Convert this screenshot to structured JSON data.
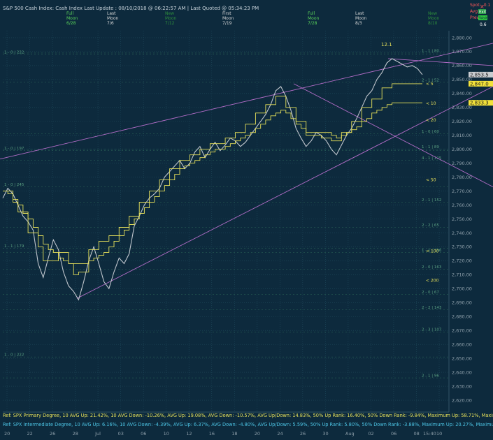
{
  "header": {
    "text": "S&P 500 Cash Index:  Cash Index  Last Update : 08/10/2018 @ 06:22:57 AM | Last Quoted @ 05:34:23 PM"
  },
  "moon_phases": [
    {
      "line1": "Full",
      "line2": "Moon",
      "line3": "6/28",
      "color": "#5ad35a"
    },
    {
      "line1": "Last",
      "line2": "Moon",
      "line3": "7/6",
      "color": "#d8d8d8"
    },
    {
      "line1": "New",
      "line2": "Moon",
      "line3": "7/12",
      "color": "#2e8f3c"
    },
    {
      "line1": "First",
      "line2": "Moon",
      "line3": "7/19",
      "color": "#d8d8d8"
    },
    {
      "line1": "Full",
      "line2": "Moon",
      "line3": "7/28",
      "color": "#5ad35a"
    },
    {
      "line1": "Last",
      "line2": "Moon",
      "line3": "8/3",
      "color": "#d8d8d8"
    },
    {
      "line1": "New",
      "line2": "Moon",
      "line3": "8/10",
      "color": "#2e8f3c"
    }
  ],
  "top_right": {
    "spot": "Spot: -0.1",
    "avg": "Avg: ",
    "avg_val": "Exit",
    "prev": "Prev: ",
    "prev_val": "Wait",
    "stat": "0.6"
  },
  "price_tags": [
    {
      "label": "2,853.5",
      "value": 2853.5,
      "bg": "#c9ccd0",
      "fg": "#1a1a1a"
    },
    {
      "label": "2,847.0",
      "value": 2847.0,
      "bg": "#f3e23a",
      "fg": "#1a1a1a"
    },
    {
      "label": "2,833.3",
      "value": 2833.3,
      "bg": "#f3e23a",
      "fg": "#1a1a1a"
    }
  ],
  "annotations": {
    "wave_label": "12.1"
  },
  "ma_labels": [
    {
      "label": "< 5",
      "value": 2847
    },
    {
      "label": "< 10",
      "value": 2833
    },
    {
      "label": "< 20",
      "value": 2821
    },
    {
      "label": "< 50",
      "value": 2778
    },
    {
      "label": "< 100",
      "value": 2727
    },
    {
      "label": "< 200",
      "value": 2706
    }
  ],
  "levels": [
    {
      "label": "1 - 0 | 222",
      "value": 2868,
      "side": "left"
    },
    {
      "label": "1 - 0 | 197",
      "value": 2799,
      "side": "left"
    },
    {
      "label": "1 - 0 | 245",
      "value": 2773,
      "side": "left"
    },
    {
      "label": "1 - 1 | 179",
      "value": 2729,
      "side": "left"
    },
    {
      "label": "1 - 0 | 222",
      "value": 2651,
      "side": "left"
    },
    {
      "label": "1 - 1 | 80",
      "value": 2869,
      "side": "right"
    },
    {
      "label": "2 - 1 | 52",
      "value": 2848,
      "side": "right"
    },
    {
      "label": "1 - 0 | 60",
      "value": 2811,
      "side": "right"
    },
    {
      "label": "1 - 1 | 89",
      "value": 2800,
      "side": "right"
    },
    {
      "label": "4 - 1 | 115",
      "value": 2792,
      "side": "right"
    },
    {
      "label": "2 - 1 | 152",
      "value": 2762,
      "side": "right"
    },
    {
      "label": "2 - 2 | 65",
      "value": 2744,
      "side": "right"
    },
    {
      "label": "1 - 1 | 196",
      "value": 2726,
      "side": "right"
    },
    {
      "label": "2 - 0 | 163",
      "value": 2714,
      "side": "right"
    },
    {
      "label": "2 - 0 | 67",
      "value": 2696,
      "side": "right"
    },
    {
      "label": "2 - 2 | 143",
      "value": 2685,
      "side": "right"
    },
    {
      "label": "2 - 3 | 107",
      "value": 2669,
      "side": "right"
    },
    {
      "label": "2 - 1 | 96",
      "value": 2636,
      "side": "right"
    }
  ],
  "refs": {
    "primary": "Ref: SPX Primary Degree, 10 AVG Up: 21.42%, 10 AVG Down: -10.26%, AVG Up: 19.08%, AVG Down: -10.57%, AVG Up/Down: 14.83%, 50%  Up Rank: 16.40%, 50% Down Rank: -9.84%, Maximum Up: 58.71%, Maximum",
    "intermediate": "Ref: SPX Intermediate Degree, 10 AVG Up: 6.16%, 10 AVG Down: -4.39%, AVG Up: 6.37%, AVG Down: -4.80%, AVG Up/Down: 5.59%, 50%  Up Rank: 5.80%, 50% Down Rank: -3.88%, Maximum Up: 20.27%, Maximum Do"
  },
  "chart_data": {
    "type": "line",
    "title": "S&P 500 Cash Index",
    "ylim": [
      2615,
      2885
    ],
    "y_ticks": [
      "2,880.00",
      "2,870.00",
      "2,860.00",
      "2,850.00",
      "2,840.00",
      "2,830.00",
      "2,820.00",
      "2,810.00",
      "2,800.00",
      "2,790.00",
      "2,780.00",
      "2,770.00",
      "2,760.00",
      "2,750.00",
      "2,740.00",
      "2,730.00",
      "2,720.00",
      "2,710.00",
      "2,700.00",
      "2,690.00",
      "2,680.00",
      "2,670.00",
      "2,660.00",
      "2,650.00",
      "2,640.00",
      "2,630.00",
      "2,620.00"
    ],
    "x_labels": [
      "20",
      "22",
      "26",
      "28",
      "Jul",
      "03",
      "06",
      "10",
      "12",
      "16",
      "18",
      "20",
      "24",
      "26",
      "30",
      "Aug",
      "02",
      "06",
      "08",
      "10"
    ],
    "x_extra": "15:40",
    "grid": true,
    "series": [
      {
        "color": "#bfc5cc",
        "values": [
          2765,
          2772,
          2768,
          2760,
          2752,
          2748,
          2742,
          2718,
          2708,
          2722,
          2735,
          2728,
          2712,
          2702,
          2698,
          2692,
          2705,
          2720,
          2730,
          2718,
          2705,
          2700,
          2712,
          2722,
          2718,
          2725,
          2745,
          2752,
          2760,
          2765,
          2768,
          2772,
          2780,
          2784,
          2788,
          2792,
          2786,
          2790,
          2798,
          2802,
          2794,
          2800,
          2805,
          2799,
          2803,
          2808,
          2806,
          2802,
          2805,
          2810,
          2815,
          2820,
          2825,
          2832,
          2842,
          2845,
          2838,
          2828,
          2815,
          2808,
          2802,
          2806,
          2812,
          2810,
          2806,
          2800,
          2796,
          2803,
          2810,
          2815,
          2822,
          2830,
          2838,
          2842,
          2850,
          2855,
          2862,
          2865,
          2863,
          2861,
          2859,
          2860,
          2858,
          2853.5
        ]
      },
      {
        "name": "5",
        "color": "#e6e05a",
        "values": [
          2770,
          2770,
          2762,
          2755,
          2755,
          2740,
          2740,
          2730,
          2720,
          2720,
          2720,
          2726,
          2726,
          2718,
          2710,
          2712,
          2712,
          2728,
          2728,
          2734,
          2734,
          2738,
          2738,
          2744,
          2744,
          2752,
          2752,
          2762,
          2762,
          2770,
          2770,
          2778,
          2778,
          2786,
          2786,
          2792,
          2792,
          2796,
          2796,
          2800,
          2800,
          2804,
          2804,
          2804,
          2808,
          2808,
          2812,
          2812,
          2818,
          2818,
          2826,
          2826,
          2832,
          2832,
          2838,
          2838,
          2830,
          2830,
          2820,
          2820,
          2810,
          2810,
          2810,
          2808,
          2808,
          2806,
          2806,
          2812,
          2812,
          2820,
          2820,
          2830,
          2830,
          2836,
          2836,
          2844,
          2844,
          2847,
          2847,
          2847,
          2847,
          2847,
          2847,
          2847
        ]
      },
      {
        "name": "10",
        "color": "#e6e05a",
        "values": [
          2770,
          2768,
          2764,
          2760,
          2754,
          2750,
          2744,
          2738,
          2732,
          2728,
          2726,
          2722,
          2720,
          2718,
          2718,
          2718,
          2718,
          2720,
          2722,
          2724,
          2726,
          2730,
          2734,
          2738,
          2742,
          2746,
          2750,
          2754,
          2758,
          2762,
          2766,
          2770,
          2774,
          2778,
          2782,
          2786,
          2788,
          2790,
          2792,
          2794,
          2796,
          2798,
          2800,
          2800,
          2802,
          2804,
          2806,
          2808,
          2810,
          2812,
          2815,
          2818,
          2821,
          2824,
          2826,
          2828,
          2826,
          2822,
          2818,
          2815,
          2812,
          2812,
          2812,
          2812,
          2812,
          2810,
          2808,
          2810,
          2812,
          2814,
          2816,
          2820,
          2822,
          2826,
          2828,
          2830,
          2832,
          2833.3,
          2833.3,
          2833.3,
          2833.3,
          2833.3,
          2833.3,
          2833.3
        ]
      }
    ]
  }
}
